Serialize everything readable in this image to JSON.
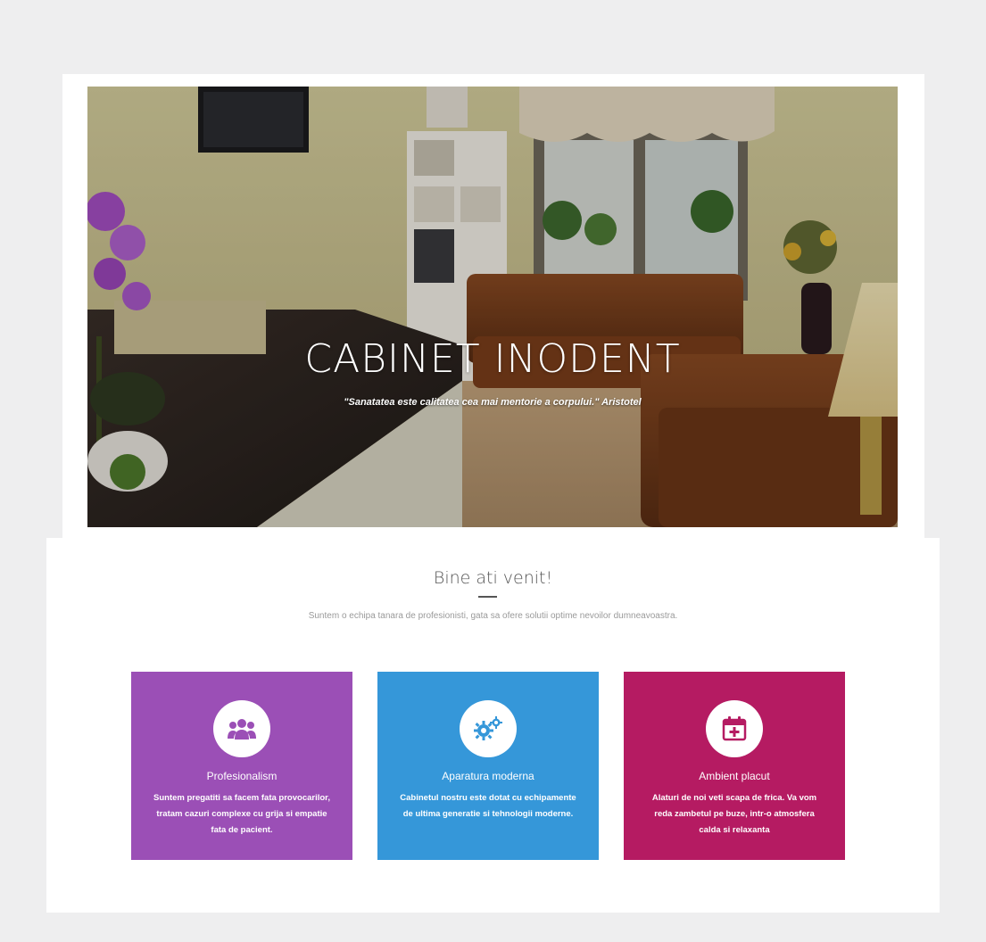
{
  "hero": {
    "title": "CABINET INODENT",
    "quote": "\"Sanatatea este calitatea cea mai mentorie a corpului.\" Aristotel"
  },
  "welcome": {
    "title": "Bine ati venit!",
    "subtitle": "Suntem o echipa tanara de profesionisti, gata sa ofere solutii optime nevoilor dumneavoastra."
  },
  "features": [
    {
      "icon": "users-icon",
      "title": "Profesionalism",
      "text": "Suntem pregatiti sa facem fata provocarilor, tratam cazuri complexe cu grija si empatie fata de pacient.",
      "color": "#9b4fb6"
    },
    {
      "icon": "gears-icon",
      "title": "Aparatura moderna",
      "text": "Cabinetul nostru este dotat cu echipamente de ultima generatie si tehnologii moderne.",
      "color": "#3597d9"
    },
    {
      "icon": "calendar-plus-icon",
      "title": "Ambient placut",
      "text": "Alaturi de noi veti scapa de frica. Va vom reda zambetul pe buze, intr-o atmosfera calda si relaxanta",
      "color": "#b51b62"
    }
  ],
  "colors": {
    "page_background": "#eeeeef",
    "heading_text": "#555555"
  }
}
